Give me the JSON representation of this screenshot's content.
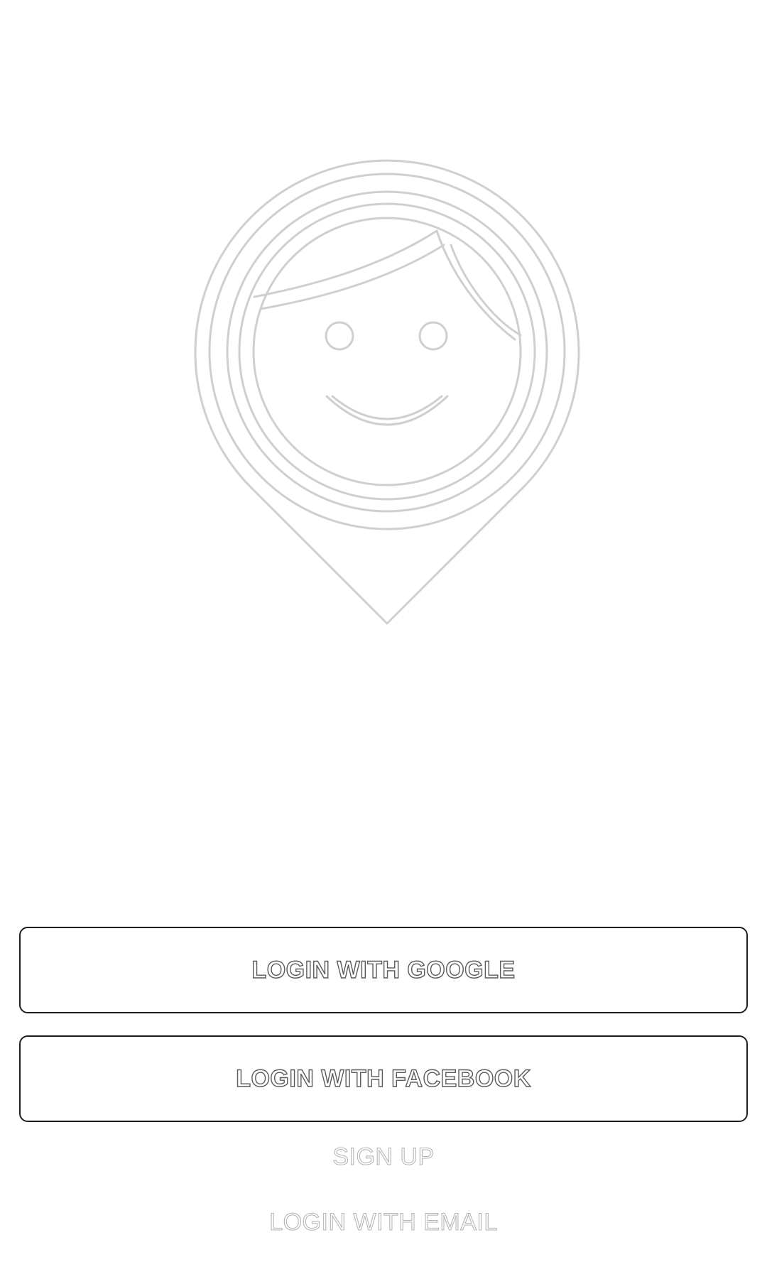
{
  "logo": {
    "icon": "smiling-face-location-pin"
  },
  "actions": {
    "google_label": "LOGIN WITH GOOGLE",
    "facebook_label": "LOGIN WITH FACEBOOK",
    "signup_label": "SIGN UP",
    "email_label": "LOGIN WITH EMAIL"
  },
  "colors": {
    "background": "#ffffff",
    "button_border": "#1e1e1e",
    "button_text_outline": "#5a5a5a",
    "link_text_outline": "#b0b0b0",
    "logo_stroke": "#d0d0d0"
  }
}
